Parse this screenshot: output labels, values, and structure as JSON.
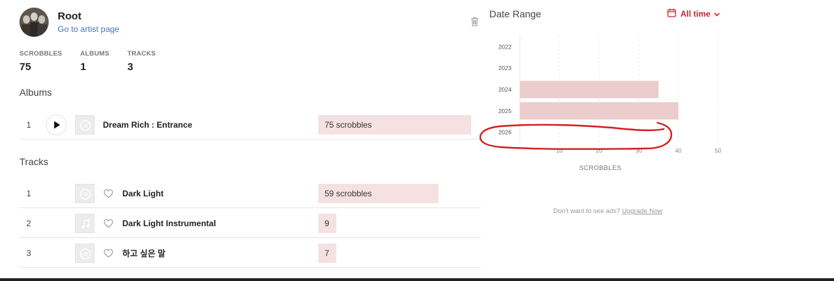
{
  "artist": {
    "name": "Root",
    "link_label": "Go to artist page"
  },
  "icons": {
    "trash": "trash-icon",
    "play": "play-icon",
    "record": "record-icon",
    "music_note": "music-note-icon",
    "heart": "heart-outline-icon",
    "calendar": "calendar-icon",
    "chevron": "chevron-down-icon"
  },
  "stats": [
    {
      "label": "SCROBBLES",
      "value": "75"
    },
    {
      "label": "ALBUMS",
      "value": "1"
    },
    {
      "label": "TRACKS",
      "value": "3"
    }
  ],
  "albums": {
    "title": "Albums",
    "items": [
      {
        "rank": "1",
        "name": "Dream Rich : Entrance",
        "scrobbles": 75,
        "label": "75 scrobbles"
      }
    ]
  },
  "tracks": {
    "title": "Tracks",
    "items": [
      {
        "rank": "1",
        "name": "Dark Light",
        "scrobbles": 59,
        "label": "59 scrobbles",
        "thumb": "record"
      },
      {
        "rank": "2",
        "name": "Dark Light Instrumental",
        "scrobbles": 9,
        "label": "9",
        "thumb": "music_note"
      },
      {
        "rank": "3",
        "name": "하고 싶은 말",
        "scrobbles": 7,
        "label": "7",
        "thumb": "record"
      }
    ]
  },
  "date_range": {
    "title": "Date Range",
    "selected": "All time"
  },
  "colors": {
    "accent": "#c8262d",
    "bar": "#f5e1e1",
    "chart_bar": "#eccccc",
    "annotation": "#d42020"
  },
  "chart_data": {
    "type": "bar",
    "orientation": "horizontal",
    "categories": [
      "2022",
      "2023",
      "2024",
      "2025",
      "2026"
    ],
    "values": [
      0,
      0,
      35,
      40,
      0
    ],
    "xlabel": "SCROBBLES",
    "xticks": [
      "10",
      "20",
      "30",
      "40",
      "50"
    ],
    "xlim": [
      0,
      50
    ],
    "grid": "vertical dashed"
  },
  "footer": {
    "ads_text": "Don't want to see ads?",
    "upgrade_label": "Upgrade Now"
  }
}
